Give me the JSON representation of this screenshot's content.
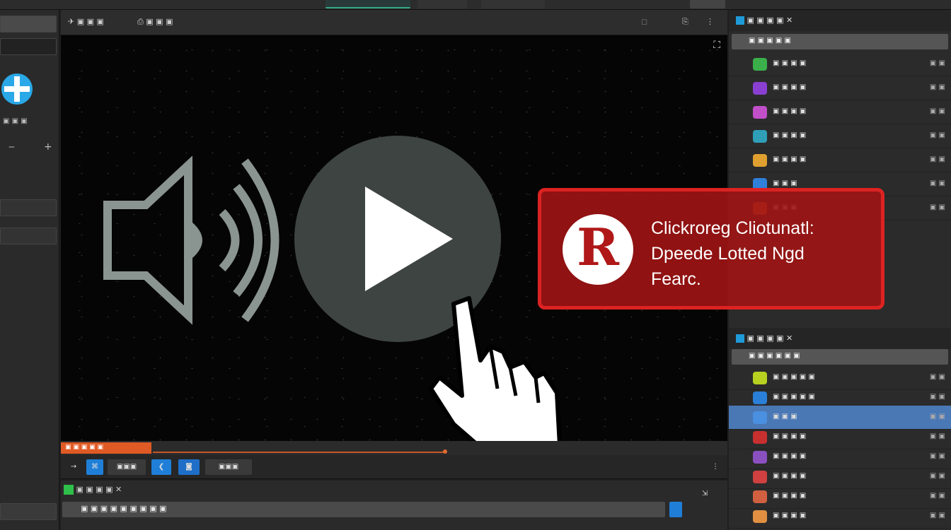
{
  "app": {
    "toolbar": {
      "item1": "▣ ▣ ▣",
      "item2": "▣ ▣ ▣"
    },
    "left_panel": {
      "label": "▣ ▣ ▣",
      "plus": "+",
      "minus": "‒"
    }
  },
  "viewport": {
    "fullscreen_icon": "fullscreen-icon",
    "play_icon": "play-icon",
    "volume_icon": "volume-icon",
    "cursor_icon": "hand-cursor-icon"
  },
  "banner": {
    "logo_letter": "R",
    "line1": "Clickroreg Cliotunatl:",
    "line2": "Dpeede Lotted Ngd",
    "line3": "Fearc."
  },
  "timeline": {
    "played_label": "▣ ▣ ▣ ▣ ▣",
    "progress": 0.58
  },
  "controls": {
    "btn_text": "▣▣▣",
    "btn2": "▣▣▣"
  },
  "bottom_panel": {
    "header": "▣ ▣ ▣ ▣  ✕",
    "bar_text": "▣ ▣ ▣ ▣ ▣ ▣ ▣ ▣ ▣"
  },
  "right_top": {
    "header": "▣ ▣ ▣ ▣  ✕",
    "sub": "▣ ▣ ▣ ▣ ▣",
    "items": [
      {
        "text": "▣ ▣ ▣ ▣",
        "right": "▣ ▣",
        "color": "#3bb04a"
      },
      {
        "text": "▣ ▣ ▣ ▣",
        "right": "▣ ▣",
        "color": "#8a3fd1"
      },
      {
        "text": "▣ ▣ ▣ ▣",
        "right": "▣ ▣",
        "color": "#c04fc8"
      },
      {
        "text": "▣ ▣ ▣ ▣",
        "right": "▣ ▣",
        "color": "#2f9fb8"
      },
      {
        "text": "▣ ▣ ▣ ▣",
        "right": "▣ ▣",
        "color": "#e0a030"
      },
      {
        "text": "▣ ▣ ▣",
        "right": "▣ ▣",
        "color": "#2f80d8"
      },
      {
        "text": "▣ ▣ ▣",
        "right": "▣ ▣",
        "color": "#e07a30"
      }
    ]
  },
  "right_bottom": {
    "header": "▣ ▣ ▣ ▣  ✕",
    "sub": "▣ ▣ ▣ ▣ ▣ ▣",
    "items": [
      {
        "text": "▣ ▣ ▣ ▣ ▣",
        "right": "▣ ▣",
        "color": "#b8d020"
      },
      {
        "text": "▣ ▣ ▣ ▣ ▣",
        "right": "▣ ▣",
        "color": "#2a7fd8"
      },
      {
        "text": "▣ ▣ ▣",
        "right": "▣ ▣",
        "color": "#4a90e0"
      },
      {
        "text": "▣ ▣ ▣ ▣",
        "right": "▣ ▣",
        "color": "#c83030"
      },
      {
        "text": "▣ ▣ ▣ ▣",
        "right": "▣ ▣",
        "color": "#8a50c0"
      },
      {
        "text": "▣ ▣ ▣ ▣",
        "right": "▣ ▣",
        "color": "#d04040"
      },
      {
        "text": "▣ ▣ ▣ ▣",
        "right": "▣ ▣",
        "color": "#d06040"
      },
      {
        "text": "▣ ▣ ▣ ▣",
        "right": "▣ ▣",
        "color": "#e09040"
      }
    ]
  }
}
